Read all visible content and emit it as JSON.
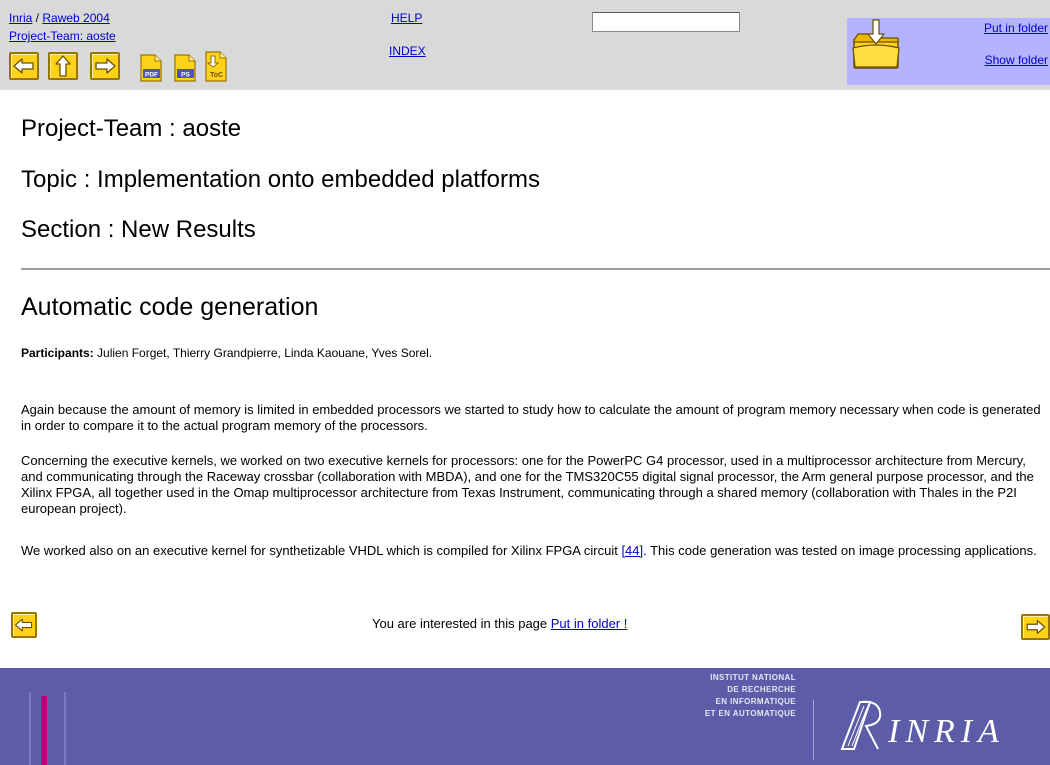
{
  "nav": {
    "crumb_root": "Inria",
    "crumb_separator": " / ",
    "crumb_report": "Raweb 2004",
    "project_link": "Project-Team: aoste",
    "help": "HELP",
    "index": "INDEX",
    "search_value": "",
    "pdf_label": "PDF",
    "ps_label": "PS",
    "toc_label": "ToC"
  },
  "folder": {
    "put_in_folder": "Put in folder",
    "show_folder": "Show folder"
  },
  "headings": {
    "project": "Project-Team : aoste",
    "topic": "Topic : Implementation onto embedded platforms",
    "section": "Section : New Results",
    "article": "Automatic code generation"
  },
  "participants": {
    "label": "Participants:",
    "names": " Julien Forget, Thierry Grandpierre, Linda Kaouane, Yves Sorel."
  },
  "paragraphs": {
    "p1": "Again because the amount of memory is limited in embedded processors we started to study how to calculate the amount of program memory necessary when code is generated in order to compare it to the actual program memory of the processors.",
    "p2": "Concerning the executive kernels, we worked on two executive kernels for processors: one for the PowerPC G4 processor, used in a multiprocessor architecture from Mercury, and communicating through the Raceway crossbar (collaboration with MBDA), and one for the TMS320C55 digital signal processor, the Arm general purpose processor, and the Xilinx FPGA, all together used in the Omap multiprocessor architecture from Texas Instrument, communicating through a shared memory (collaboration with Thales in the P2I european project).",
    "p3_before": "We worked also on an executive kernel for synthetizable VHDL which is compiled for Xilinx FPGA circuit ",
    "p3_ref": "[44]",
    "p3_after": ". This code generation was tested on image processing applications."
  },
  "bottom": {
    "interested": "You are interested in this page ",
    "put_in_folder": "Put in folder !"
  },
  "footer": {
    "institute_lines": [
      "INSTITUT NATIONAL",
      "DE RECHERCHE",
      "EN INFORMATIQUE",
      "ET EN AUTOMATIQUE"
    ],
    "logo_text": "INRIA"
  },
  "colors": {
    "nav_background": "#d9d9d9",
    "folder_panel": "#b3b3ff",
    "button_yellow": "#ffd21a",
    "link_blue": "#0000cc",
    "footer_background": "#5c5ca8",
    "footer_accent": "#c0007a"
  },
  "icons": [
    "arrow-left-icon",
    "arrow-up-icon",
    "arrow-right-icon",
    "pdf-icon",
    "ps-icon",
    "toc-icon",
    "folder-icon",
    "inria-logo-icon"
  ]
}
